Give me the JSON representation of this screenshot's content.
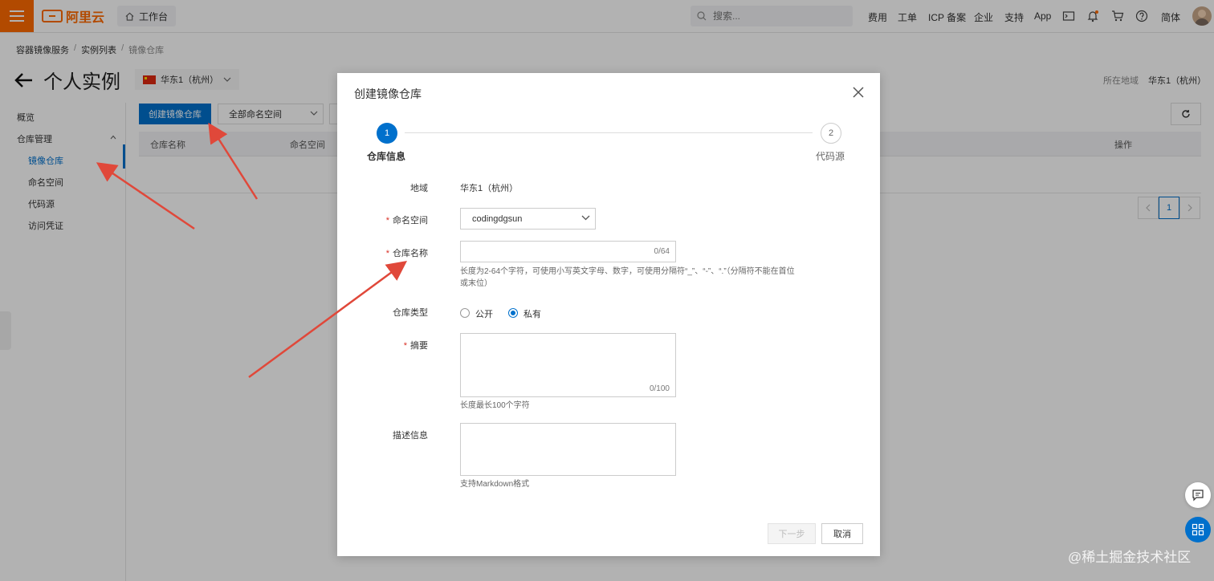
{
  "header": {
    "logo_text": "阿里云",
    "workbench_label": "工作台",
    "search_placeholder": "搜索...",
    "nav": [
      "费用",
      "工单",
      "ICP 备案",
      "企业",
      "支持",
      "App"
    ],
    "lang_label": "简体"
  },
  "breadcrumb": [
    "容器镜像服务",
    "实例列表",
    "镜像仓库"
  ],
  "page": {
    "title": "个人实例",
    "region_selector": "华东1（杭州）",
    "region_label": "所在地域",
    "region_value": "华东1（杭州）"
  },
  "sidebar": {
    "items": [
      {
        "label": "概览"
      },
      {
        "label": "仓库管理"
      },
      {
        "label": "镜像仓库"
      },
      {
        "label": "命名空间"
      },
      {
        "label": "代码源"
      },
      {
        "label": "访问凭证"
      }
    ]
  },
  "toolbar": {
    "create_label": "创建镜像仓库",
    "namespace_filter": "全部命名空间"
  },
  "table": {
    "columns": [
      "仓库名称",
      "命名空间",
      "操作"
    ],
    "page": "1"
  },
  "modal": {
    "title": "创建镜像仓库",
    "steps": [
      {
        "num": "1",
        "label": "仓库信息"
      },
      {
        "num": "2",
        "label": "代码源"
      }
    ],
    "fields": {
      "region_label": "地域",
      "region_value": "华东1（杭州）",
      "namespace_label": "命名空间",
      "namespace_value": "codingdgsun",
      "name_label": "仓库名称",
      "name_value": "",
      "name_count": "0/64",
      "name_help_line1": "长度为2-64个字符，可使用小写英文字母、数字，可使用分隔符“_”、“-”、“.”（分隔符不能在首位",
      "name_help_line2": "或末位）",
      "type_label": "仓库类型",
      "type_public": "公开",
      "type_private": "私有",
      "summary_label": "摘要",
      "summary_count": "0/100",
      "summary_help": "长度最长100个字符",
      "desc_label": "描述信息",
      "desc_help": "支持Markdown格式"
    },
    "next_label": "下一步",
    "cancel_label": "取消"
  },
  "watermark": "@稀土掘金技术社区",
  "colors": {
    "brand": "#ff6a00",
    "primary": "#0070cc",
    "required": "#d93026"
  }
}
